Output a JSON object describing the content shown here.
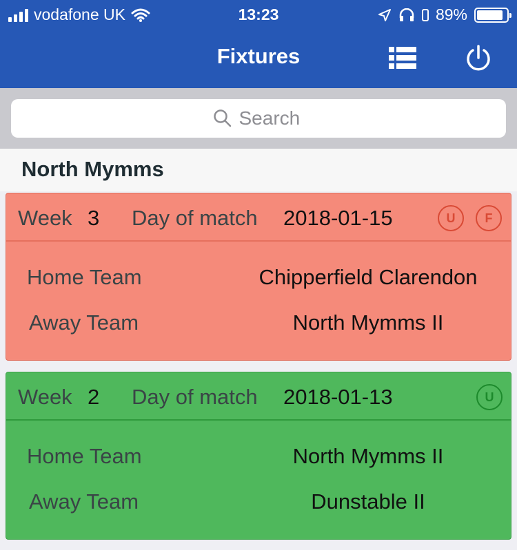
{
  "status_bar": {
    "carrier": "vodafone UK",
    "time": "13:23",
    "battery_percent": "89%",
    "battery_level": 0.89
  },
  "nav": {
    "title": "Fixtures",
    "list_icon": "list-icon",
    "power_icon": "power-icon"
  },
  "search": {
    "placeholder": "Search",
    "value": ""
  },
  "section": {
    "title": "North Mymms"
  },
  "fixtures": [
    {
      "status_color": "#f58a7a",
      "week_label": "Week",
      "week": "3",
      "day_label": "Day of match",
      "date": "2018-01-15",
      "badges": [
        "U",
        "F"
      ],
      "home_label": "Home Team",
      "home_team": "Chipperfield Clarendon",
      "away_label": "Away Team",
      "away_team": "North Mymms II"
    },
    {
      "status_color": "#4fb85c",
      "week_label": "Week",
      "week": "2",
      "day_label": "Day of match",
      "date": "2018-01-13",
      "badges": [
        "U"
      ],
      "home_label": "Home Team",
      "home_team": "North Mymms II",
      "away_label": "Away Team",
      "away_team": "Dunstable II"
    }
  ]
}
